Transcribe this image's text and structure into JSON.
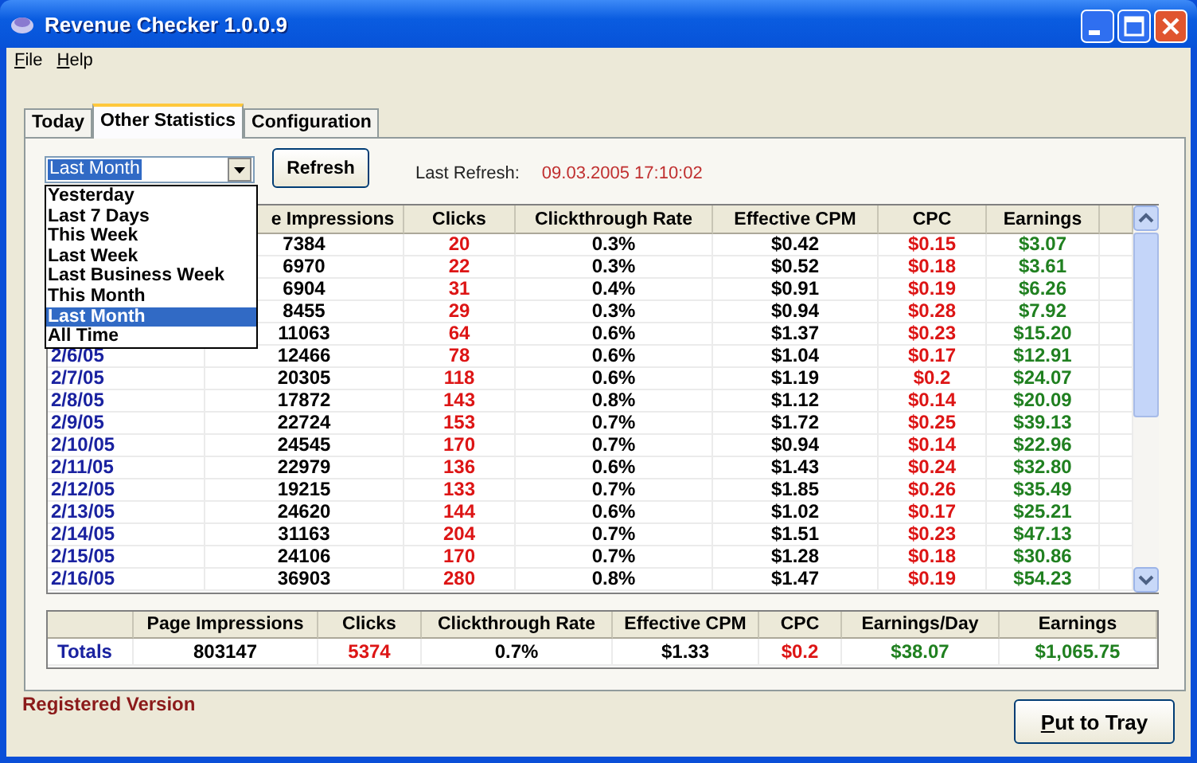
{
  "window": {
    "title": "Revenue Checker 1.0.0.9"
  },
  "menu": [
    "File",
    "Help"
  ],
  "tabs": [
    {
      "label": "Today",
      "selected": false
    },
    {
      "label": "Other Statistics",
      "selected": true
    },
    {
      "label": "Configuration",
      "selected": false
    }
  ],
  "period_combo": {
    "value": "Last Month",
    "expanded": true,
    "options": [
      {
        "label": "Yesterday",
        "selected": false
      },
      {
        "label": "Last 7 Days",
        "selected": false
      },
      {
        "label": "This Week",
        "selected": false
      },
      {
        "label": "Last Week",
        "selected": false
      },
      {
        "label": "Last Business Week",
        "selected": false
      },
      {
        "label": "This Month",
        "selected": false
      },
      {
        "label": "Last Month",
        "selected": true
      },
      {
        "label": "All Time",
        "selected": false
      }
    ]
  },
  "refresh_button": "Refresh",
  "last_refresh": {
    "label": "Last Refresh:",
    "value": "09.03.2005 17:10:02"
  },
  "table": {
    "header": {
      "impressions": "e Impressions",
      "clicks": "Clicks",
      "ctr": "Clickthrough Rate",
      "cpm": "Effective CPM",
      "cpc": "CPC",
      "earnings": "Earnings"
    },
    "rows": [
      {
        "impressions": "7384",
        "clicks": "20",
        "ctr": "0.3%",
        "cpm": "$0.42",
        "cpc": "$0.15",
        "earnings": "$3.07"
      },
      {
        "impressions": "6970",
        "clicks": "22",
        "ctr": "0.3%",
        "cpm": "$0.52",
        "cpc": "$0.18",
        "earnings": "$3.61"
      },
      {
        "impressions": "6904",
        "clicks": "31",
        "ctr": "0.4%",
        "cpm": "$0.91",
        "cpc": "$0.19",
        "earnings": "$6.26"
      },
      {
        "impressions": "8455",
        "clicks": "29",
        "ctr": "0.3%",
        "cpm": "$0.94",
        "cpc": "$0.28",
        "earnings": "$7.92"
      },
      {
        "impressions": "11063",
        "clicks": "64",
        "ctr": "0.6%",
        "cpm": "$1.37",
        "cpc": "$0.23",
        "earnings": "$15.20"
      },
      {
        "date": "2/6/05",
        "impressions": "12466",
        "clicks": "78",
        "ctr": "0.6%",
        "cpm": "$1.04",
        "cpc": "$0.17",
        "earnings": "$12.91"
      },
      {
        "date": "2/7/05",
        "impressions": "20305",
        "clicks": "118",
        "ctr": "0.6%",
        "cpm": "$1.19",
        "cpc": "$0.2",
        "earnings": "$24.07"
      },
      {
        "date": "2/8/05",
        "impressions": "17872",
        "clicks": "143",
        "ctr": "0.8%",
        "cpm": "$1.12",
        "cpc": "$0.14",
        "earnings": "$20.09"
      },
      {
        "date": "2/9/05",
        "impressions": "22724",
        "clicks": "153",
        "ctr": "0.7%",
        "cpm": "$1.72",
        "cpc": "$0.25",
        "earnings": "$39.13"
      },
      {
        "date": "2/10/05",
        "impressions": "24545",
        "clicks": "170",
        "ctr": "0.7%",
        "cpm": "$0.94",
        "cpc": "$0.14",
        "earnings": "$22.96"
      },
      {
        "date": "2/11/05",
        "impressions": "22979",
        "clicks": "136",
        "ctr": "0.6%",
        "cpm": "$1.43",
        "cpc": "$0.24",
        "earnings": "$32.80"
      },
      {
        "date": "2/12/05",
        "impressions": "19215",
        "clicks": "133",
        "ctr": "0.7%",
        "cpm": "$1.85",
        "cpc": "$0.26",
        "earnings": "$35.49"
      },
      {
        "date": "2/13/05",
        "impressions": "24620",
        "clicks": "144",
        "ctr": "0.6%",
        "cpm": "$1.02",
        "cpc": "$0.17",
        "earnings": "$25.21"
      },
      {
        "date": "2/14/05",
        "impressions": "31163",
        "clicks": "204",
        "ctr": "0.7%",
        "cpm": "$1.51",
        "cpc": "$0.23",
        "earnings": "$47.13"
      },
      {
        "date": "2/15/05",
        "impressions": "24106",
        "clicks": "170",
        "ctr": "0.7%",
        "cpm": "$1.28",
        "cpc": "$0.18",
        "earnings": "$30.86"
      },
      {
        "date": "2/16/05",
        "impressions": "36903",
        "clicks": "280",
        "ctr": "0.8%",
        "cpm": "$1.47",
        "cpc": "$0.19",
        "earnings": "$54.23"
      }
    ]
  },
  "totals": {
    "header": {
      "impressions": "Page Impressions",
      "clicks": "Clicks",
      "ctr": "Clickthrough Rate",
      "cpm": "Effective CPM",
      "cpc": "CPC",
      "earnings_per_day": "Earnings/Day",
      "earnings": "Earnings"
    },
    "row": {
      "label": "Totals",
      "impressions": "803147",
      "clicks": "5374",
      "ctr": "0.7%",
      "cpm": "$1.33",
      "cpc": "$0.2",
      "earnings_per_day": "$38.07",
      "earnings": "$1,065.75"
    }
  },
  "status": "Registered Version",
  "tray_button": "Put to Tray"
}
